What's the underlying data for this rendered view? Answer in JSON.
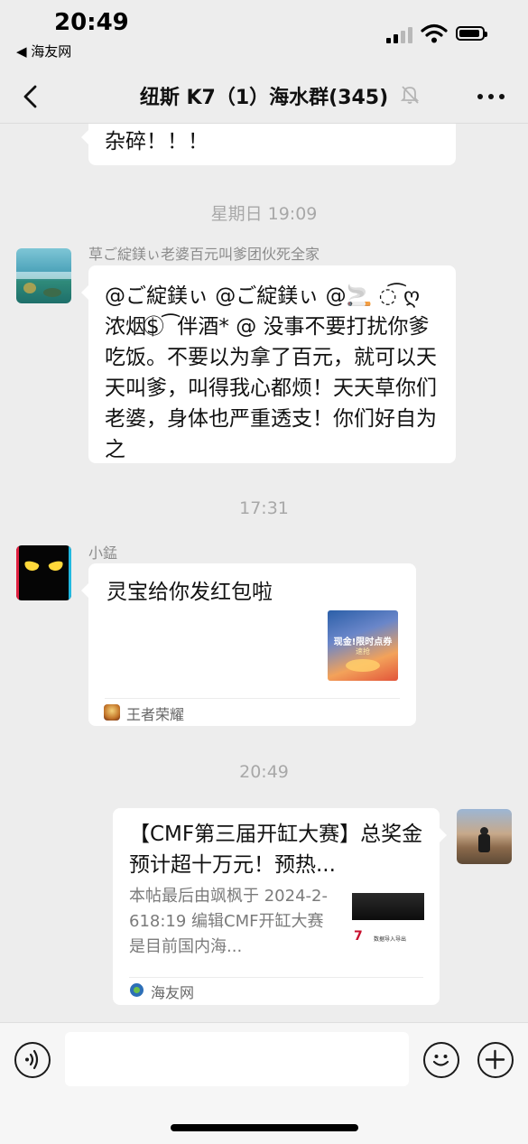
{
  "status_bar": {
    "time": "20:49",
    "back_app": "◀ 海友网"
  },
  "nav": {
    "title": "纽斯 K7（1）海水群(345)"
  },
  "messages": {
    "m0": {
      "text": "杂碎！！！"
    },
    "ts1": "星期日 19:09",
    "m1": {
      "sender": "草ご綻鎂ぃ老婆百元叫爹团伙死全家",
      "text": "@ご綻鎂ぃ @ご綻鎂ぃ @🚬 ◌͡ ღ浓烟$ ⃝ ͡ 伴酒* @  没事不要打扰你爹吃饭。不要以为拿了百元，就可以天天叫爹，叫得我心都烦！天天草你们老婆，身体也严重透支！你们好自为之"
    },
    "ts2": "17:31",
    "m2": {
      "sender": "小錳",
      "title": "灵宝给你发红包啦",
      "thumb_line1": "现金!限时点券",
      "thumb_line2": "速抢",
      "source": "王者荣耀"
    },
    "ts3": "20:49",
    "m3": {
      "title": "【CMF第三届开缸大赛】总奖金预计超十万元！预热...",
      "desc": "本帖最后由飒枫于 2024-2-618:19 编辑CMF开缸大赛是目前国内海...",
      "thumb_small": "7",
      "thumb_caption": "数据导入导出",
      "source": "海友网"
    }
  },
  "colors": {
    "background": "#ededed",
    "bubble": "#ffffff",
    "timestamp": "#a8a8a8",
    "accent": "#07c160"
  }
}
